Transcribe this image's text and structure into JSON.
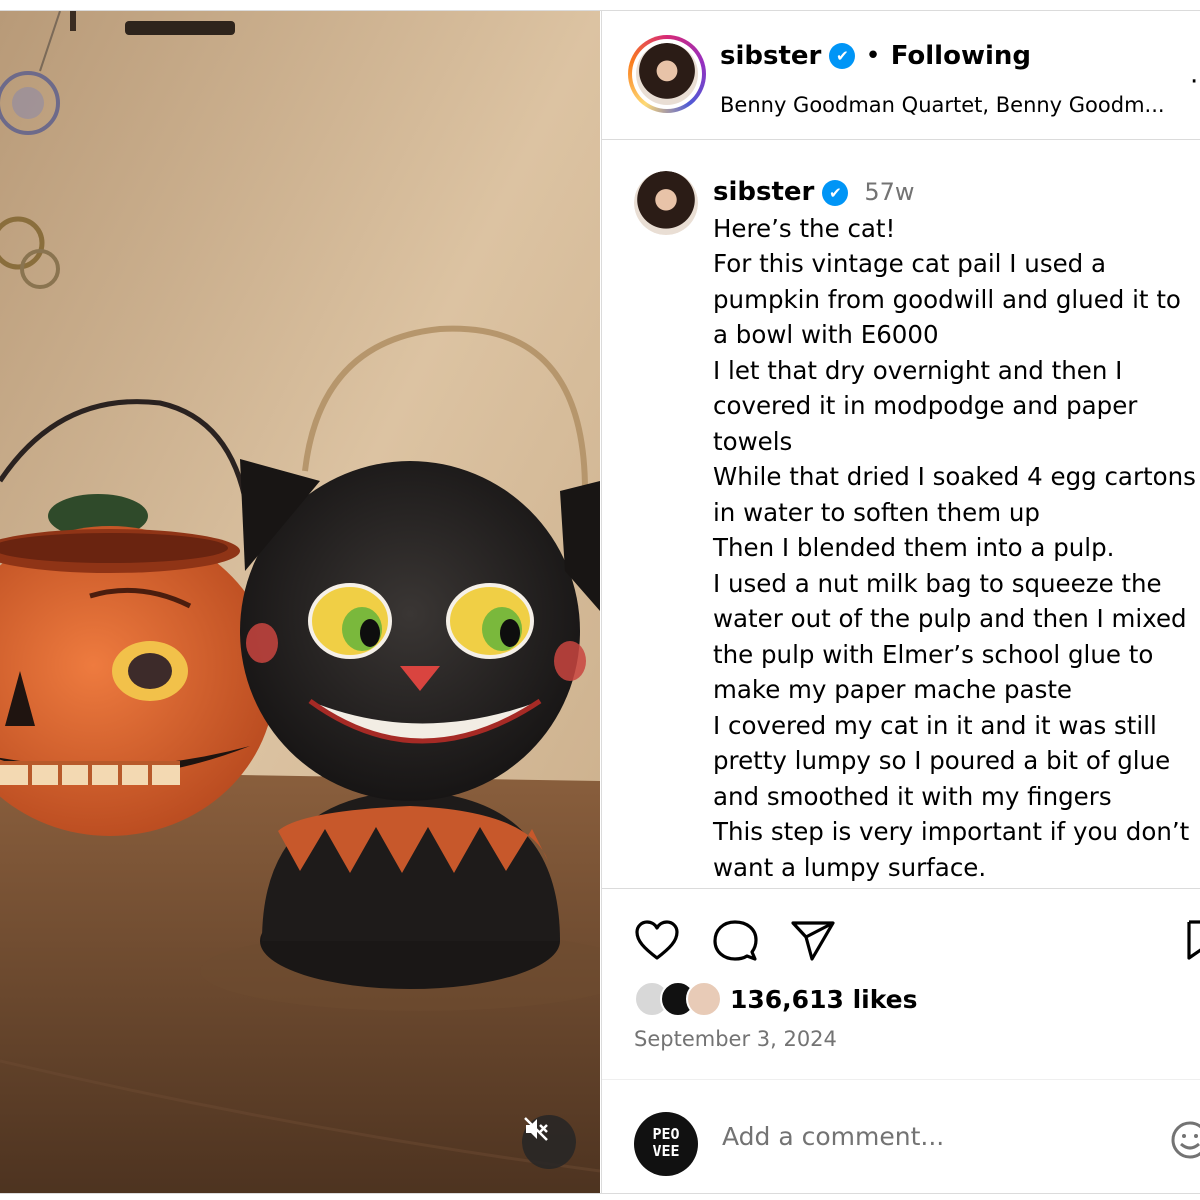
{
  "header": {
    "username": "sibster",
    "verified_glyph": "✔",
    "separator": "•",
    "follow_status": "Following",
    "audio": "Benny Goodman Quartet, Benny Goodm...",
    "more_glyph": "·"
  },
  "caption": {
    "username": "sibster",
    "age": "57w",
    "lines": [
      "Here’s the cat!",
      "For this vintage cat pail  I used a",
      "pumpkin from goodwill and glued it to",
      "a bowl with E6000",
      "I let that dry overnight and then I",
      "covered it in modpodge and paper",
      "towels",
      "While that dried I soaked 4 egg cartons",
      "in water to soften them up",
      "Then I blended them into a pulp.",
      "I used a nut milk bag to squeeze the",
      "water out of the pulp and then I mixed",
      "the pulp with Elmer’s school glue to",
      "make my paper mache paste",
      "I covered my cat in it and it was still",
      "pretty lumpy so I poured a bit of glue",
      "and smoothed it with my fingers",
      "This step is very important if you don’t",
      "want a lumpy surface."
    ]
  },
  "actions": {
    "likes": "136,613 likes",
    "date": "September 3, 2024"
  },
  "comment": {
    "avatar_text_line1": "PEO",
    "avatar_text_line2": "VEE",
    "placeholder": "Add a comment..."
  },
  "icons": {
    "like": "heart-icon",
    "comment": "comment-icon",
    "share": "share-icon",
    "save": "bookmark-icon",
    "mute": "muted-speaker-icon",
    "emoji": "emoji-icon"
  },
  "colors": {
    "verified": "#0095f6",
    "muted_text": "#737373",
    "divider": "#dbdbdb"
  }
}
